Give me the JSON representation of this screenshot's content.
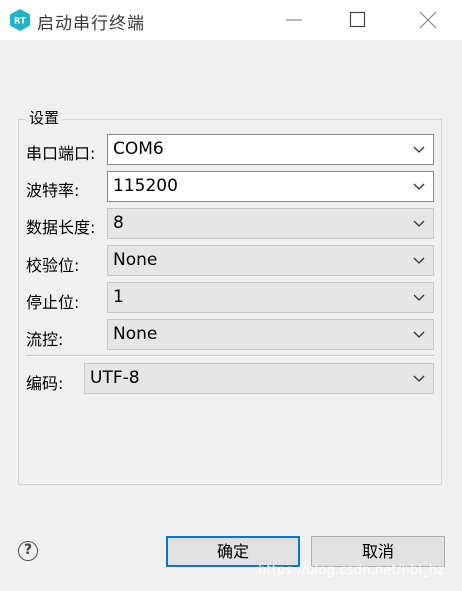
{
  "window": {
    "title": "启动串行终端",
    "app_icon": "rt-thread-logo",
    "app_icon_text": "RT",
    "controls": [
      "minimize-icon",
      "maximize-icon",
      "close-icon"
    ]
  },
  "settings": {
    "group_label": "设置",
    "serial_port": {
      "label": "串口端口:",
      "value": "COM6"
    },
    "baud_rate": {
      "label": "波特率:",
      "value": "115200"
    },
    "data_bits": {
      "label": "数据长度:",
      "value": "8"
    },
    "parity": {
      "label": "校验位:",
      "value": "None"
    },
    "stop_bits": {
      "label": "停止位:",
      "value": "1"
    },
    "flow_control": {
      "label": "流控:",
      "value": "None"
    },
    "encoding": {
      "label": "编码:",
      "value": "UTF-8"
    }
  },
  "footer": {
    "help_icon": "help-icon",
    "ok_label": "确定",
    "cancel_label": "取消"
  },
  "watermark": "https://blog.csdn.net/hbl_hz",
  "colors": {
    "dialog_bg": "#f0f0f0",
    "titlebar_bg": "#ffffff",
    "logo_teal": "#1bb5c9",
    "focus_blue": "#0078d7"
  }
}
